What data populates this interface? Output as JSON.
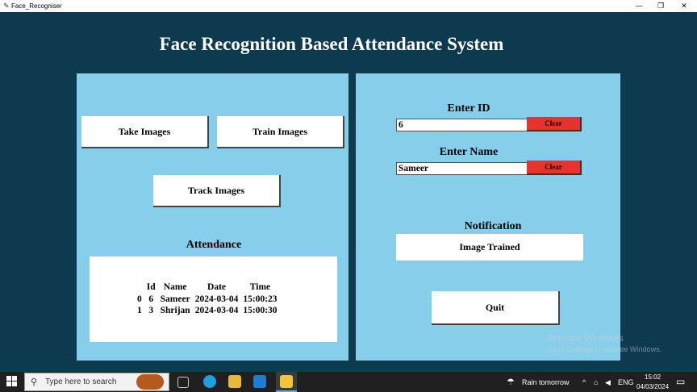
{
  "window": {
    "title": "Face_Recogniser",
    "minimize": "—",
    "maximize": "❐",
    "close": "✕"
  },
  "main_title": "Face Recognition Based Attendance System",
  "left_panel": {
    "take_images": "Take Images",
    "train_images": "Train Images",
    "track_images": "Track Images",
    "attendance_label": "Attendance",
    "table": {
      "headers": [
        "",
        "Id",
        "Name",
        "Date",
        "Time"
      ],
      "rows": [
        [
          "0",
          "6",
          "Sameer",
          "2024-03-04",
          "15:00:23"
        ],
        [
          "1",
          "3",
          "Shrijan",
          "2024-03-04",
          "15:00:30"
        ]
      ]
    }
  },
  "right_panel": {
    "enter_id_label": "Enter ID",
    "id_value": "6",
    "enter_name_label": "Enter Name",
    "name_value": "Sameer",
    "clear_label": "Clear",
    "notification_label": "Notification",
    "notification_message": "Image Trained",
    "quit_label": "Quit"
  },
  "watermark": {
    "line1": "Activate Windows",
    "line2": "Go to Settings to activate Windows."
  },
  "taskbar": {
    "search_placeholder": "Type here to search",
    "weather": "Rain tomorrow",
    "language": "ENG",
    "time": "15:02",
    "date": "04/03/2024",
    "icons": [
      "windows-start-icon",
      "search-icon",
      "task-view-icon",
      "edge-icon",
      "file-explorer-icon",
      "vscode-icon",
      "python-icon",
      "weather-icon",
      "chevron-up-icon",
      "network-icon",
      "volume-icon",
      "notification-icon"
    ]
  },
  "colors": {
    "background": "#0d3a4e",
    "panel": "#87ceeb",
    "clear_button": "#e8322c",
    "white": "#ffffff"
  }
}
